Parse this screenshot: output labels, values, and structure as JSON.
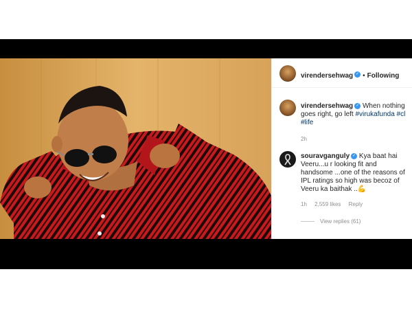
{
  "post": {
    "author": {
      "username": "virendersehwag",
      "verified": true,
      "follow_status": "Following",
      "avatar_icon": "profile-avatar"
    },
    "caption": {
      "username": "virendersehwag",
      "text": "When nothing goes right, go left",
      "hashtags": [
        "#virukafunda",
        "#cl",
        "#life"
      ],
      "time": "2h"
    },
    "comments": [
      {
        "username": "souravganguly",
        "verified": true,
        "text": "Kya baat hai Veeru...u r looking fit and handsome ...one of the reasons of IPL ratings so high was becoz of Veeru ka baithak ..",
        "emoji": "flexed-biceps",
        "time": "1h",
        "likes": "2,559 likes",
        "reply_label": "Reply",
        "view_replies": "View replies (61)"
      }
    ]
  },
  "colors": {
    "link": "#00376b",
    "verified": "#3897f0",
    "muted": "#8e8e8e",
    "text": "#262626"
  }
}
